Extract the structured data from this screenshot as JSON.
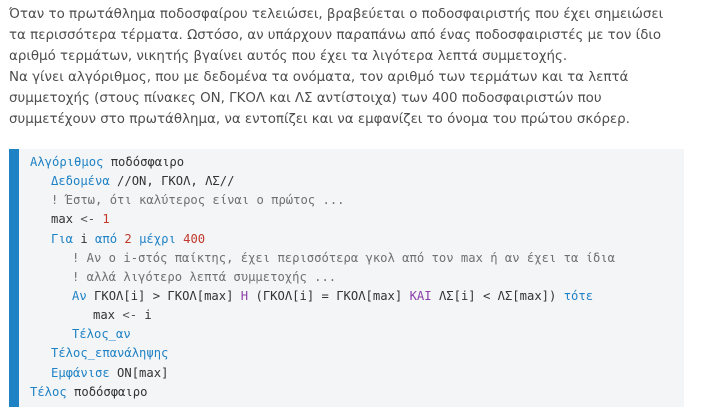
{
  "problem": {
    "lines": [
      "Όταν το πρωτάθλημα ποδοσφαίρου τελειώσει, βραβεύεται ο ποδοσφαιριστής που έχει σημειώσει",
      "τα περισσότερα τέρματα. Ωστόσο, αν υπάρχουν παραπάνω από ένας ποδοσφαιριστές με τον ίδιο",
      "αριθμό τερμάτων, νικητής βγαίνει αυτός που έχει τα λιγότερα λεπτά συμμετοχής.",
      "Να γίνει αλγόριθμος, που με δεδομένα τα ονόματα, τον αριθμό των τερμάτων και τα λεπτά",
      "συμμετοχής (στους πίνακες ΟΝ, ΓΚΟΛ και ΛΣ αντίστοιχα) των 400 ποδοσφαιριστών που",
      "συμμετέχουν στο πρωτάθλημα, να εντοπίζει και να εμφανίζει το όνομα του πρώτου σκόρερ."
    ]
  },
  "code": {
    "l1": {
      "kw": "Αλγόριθμος",
      "name": "ποδόσφαιρο"
    },
    "l2": {
      "kw": "Δεδομένα",
      "rest": "//ΟΝ, ΓΚΟΛ, ΛΣ//"
    },
    "l3": {
      "comment": "! Έστω, ότι καλύτερος είναι ο πρώτος ..."
    },
    "l4": {
      "var": "max",
      "assign": "<-",
      "num": "1"
    },
    "l5": {
      "kw1": "Για",
      "var": "i",
      "kw2": "από",
      "num1": "2",
      "kw3": "μέχρι",
      "num2": "400"
    },
    "l6": {
      "comment": "! Αν ο i-στός παίκτης, έχει περισσότερα γκολ από τον max ή αν έχει τα ίδια"
    },
    "l7": {
      "comment": "! αλλά λιγότερο λεπτά συμμετοχής ..."
    },
    "l8": {
      "kw_if": "Αν",
      "c1": "ΓΚΟΛ[i] > ΓΚΟΛ[max]",
      "or": "Η",
      "c2": "(ΓΚΟΛ[i] = ΓΚΟΛ[max]",
      "and": "ΚΑΙ",
      "c3": "ΛΣ[i] < ΛΣ[max])",
      "kw_then": "τότε"
    },
    "l9": {
      "var": "max",
      "assign": "<-",
      "value": "i"
    },
    "l10": {
      "kw": "Τέλος_αν"
    },
    "l11": {
      "kw": "Τέλος_επανάληψης"
    },
    "l12": {
      "kw": "Εμφάνισε",
      "expr": "ΟΝ[max]"
    },
    "l13": {
      "kw": "Τέλος",
      "name": "ποδόσφαιρο"
    }
  },
  "colors": {
    "accent": "#1f82c4",
    "number": "#c0392b",
    "comment": "#707070",
    "code_background": "#f4f5f7",
    "text": "#4d4d4d"
  }
}
